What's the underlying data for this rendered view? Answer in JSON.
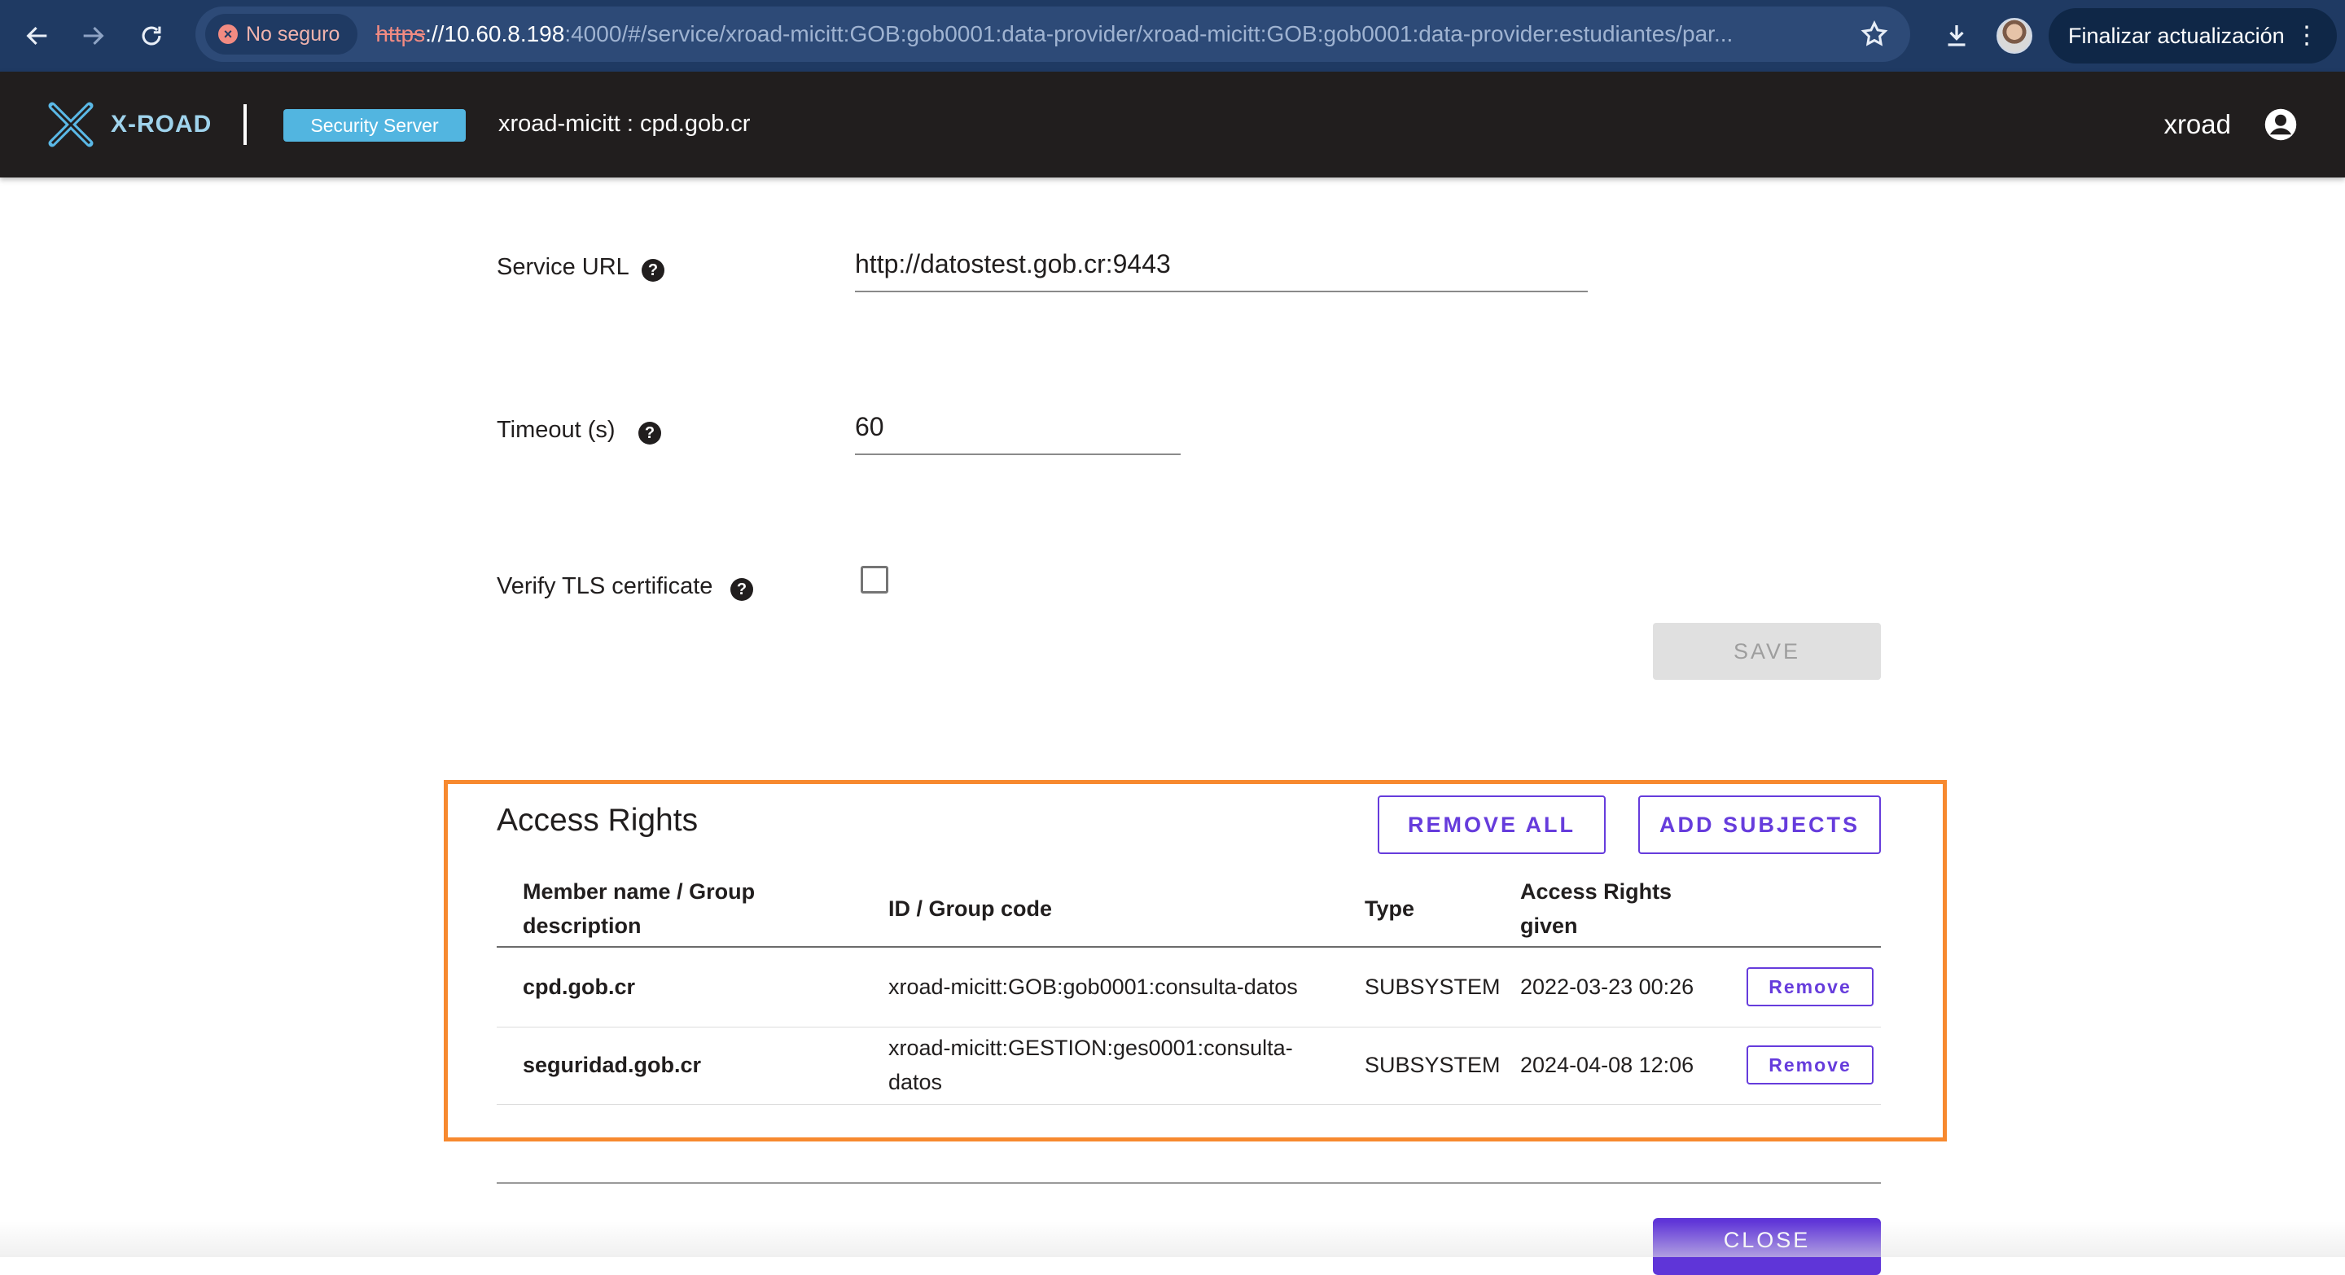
{
  "browser": {
    "security_label": "No seguro",
    "url_scheme": "https",
    "url_host": "://10.60.8.198",
    "url_rest": ":4000/#/service/xroad-micitt:GOB:gob0001:data-provider/xroad-micitt:GOB:gob0001:data-provider:estudiantes/par...",
    "update_button": "Finalizar actualización"
  },
  "header": {
    "logo_text": "X-ROAD",
    "badge": "Security Server",
    "server_name": "xroad-micitt : cpd.gob.cr",
    "user": "xroad"
  },
  "form": {
    "service_url_label": "Service URL",
    "service_url_value": "http://datostest.gob.cr:9443",
    "timeout_label": "Timeout (s)",
    "timeout_value": "60",
    "tls_label": "Verify TLS certificate",
    "tls_checked": false,
    "save_label": "SAVE"
  },
  "access_rights": {
    "title": "Access Rights",
    "remove_all_label": "REMOVE ALL",
    "add_subjects_label": "ADD SUBJECTS",
    "columns": {
      "member_line1": "Member name / Group",
      "member_line2": "description",
      "id": "ID / Group code",
      "type": "Type",
      "given_line1": "Access Rights",
      "given_line2": "given"
    },
    "rows": [
      {
        "member": "cpd.gob.cr",
        "id_line1": "xroad-micitt:GOB:gob0001:consulta-datos",
        "id_line2": "",
        "type": "SUBSYSTEM",
        "given": "2022-03-23 00:26",
        "action": "Remove"
      },
      {
        "member": "seguridad.gob.cr",
        "id_line1": "xroad-micitt:GESTION:ges0001:consulta-",
        "id_line2": "datos",
        "type": "SUBSYSTEM",
        "given": "2024-04-08 12:06",
        "action": "Remove"
      }
    ]
  },
  "footer": {
    "close_label": "CLOSE"
  },
  "colors": {
    "accent": "#663cdc",
    "highlight_border": "#f7892f",
    "header_bg": "#211e1e",
    "badge_bg": "#52b5e0"
  }
}
